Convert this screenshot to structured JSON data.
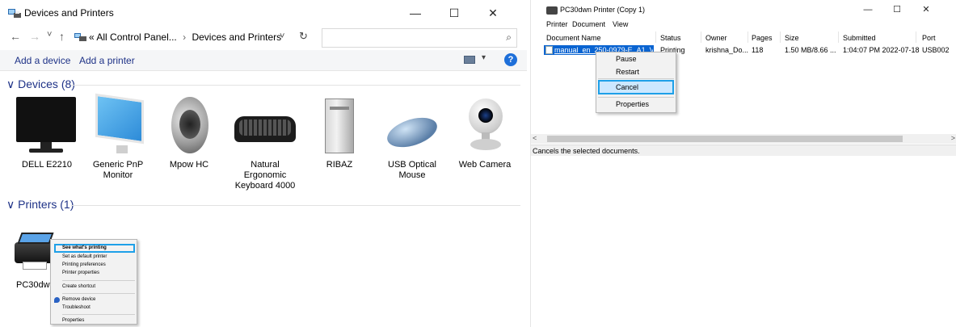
{
  "left_window": {
    "title": "Devices and Printers",
    "controls": {
      "minimize": "—",
      "maximize": "☐",
      "close": "✕"
    },
    "nav": {
      "back": "←",
      "forward": "→",
      "recent": "˅",
      "up": "↑"
    },
    "breadcrumb": {
      "prefix": "«",
      "parent": "All Control Panel...",
      "sep": "›",
      "current": "Devices and Printers",
      "dropdown": "˅"
    },
    "refresh": "↻",
    "search_placeholder": "",
    "search_icon": "⌕",
    "toolbar": {
      "add_device": "Add a device",
      "add_printer": "Add a printer",
      "view_arrow": "▾",
      "help": "?"
    },
    "devices_group": {
      "chevron": "∨",
      "label": "Devices (8)"
    },
    "devices": [
      {
        "name": "DELL E2210",
        "icon": "monitor-icon"
      },
      {
        "name": "Generic PnP Monitor",
        "icon": "monitor-icon"
      },
      {
        "name": "Mpow HC",
        "icon": "speaker-icon"
      },
      {
        "name": "Natural Ergonomic Keyboard 4000",
        "icon": "keyboard-icon"
      },
      {
        "name": "RIBAZ",
        "icon": "computer-tower-icon"
      },
      {
        "name": "USB Optical Mouse",
        "icon": "mouse-icon"
      },
      {
        "name": "Web Camera",
        "icon": "webcam-icon"
      }
    ],
    "printers_group": {
      "chevron": "∨",
      "label": "Printers (1)"
    },
    "printer": {
      "name": "PC30dwn",
      "icon": "printer-icon"
    },
    "context_menu": [
      "See what's printing",
      "Set as default printer",
      "Printing preferences",
      "Printer properties",
      "Create shortcut",
      "Remove device",
      "Troubleshoot",
      "Properties"
    ]
  },
  "right_window": {
    "title": "PC30dwn Printer (Copy 1)",
    "controls": {
      "minimize": "—",
      "maximize": "☐",
      "close": "✕"
    },
    "menu": [
      "Printer",
      "Document",
      "View"
    ],
    "columns": [
      "Document Name",
      "Status",
      "Owner",
      "Pages",
      "Size",
      "Submitted",
      "Port"
    ],
    "row": {
      "document": "manual_en_250-0979-E_A1_V10...",
      "status": "Printing",
      "owner": "krishna_Do...",
      "pages": "118",
      "size": "1.50 MB/8.66 ...",
      "submitted": "1:04:07 PM  2022-07-18",
      "port": "USB002"
    },
    "context_menu": [
      "Pause",
      "Restart",
      "Cancel",
      "Properties"
    ],
    "scroll_left": "<",
    "scroll_right": ">",
    "status_text": "Cancels the selected documents."
  },
  "colors": {
    "link_blue": "#1e3287",
    "selection": "#0a64d1",
    "highlight_border": "#1ea0e8"
  }
}
